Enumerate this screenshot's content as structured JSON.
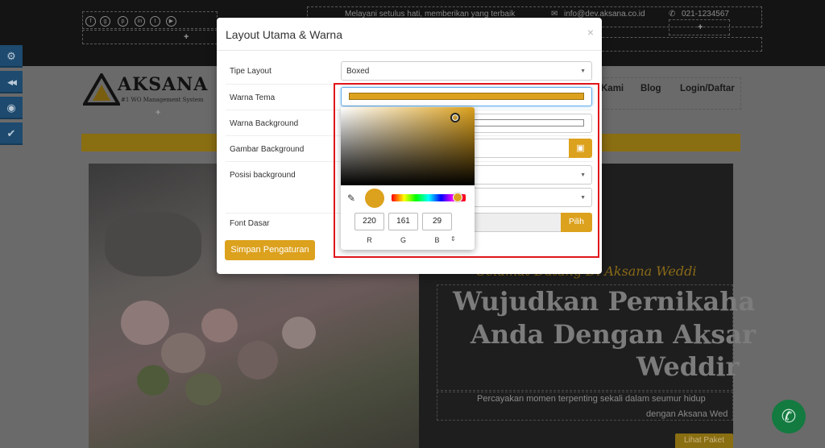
{
  "background_page": {
    "top_bar": {
      "tagline": "Melayani setulus hati, memberikan yang terbaik",
      "email": "info@dev.aksana.co.id",
      "phone": "021-1234567",
      "add_symbol": "+"
    },
    "logo": {
      "name": "AKSANA",
      "tagline": "#1 WO Management System"
    },
    "nav": [
      {
        "label": "Kami"
      },
      {
        "label": "Blog"
      },
      {
        "label": "Login/Daftar"
      }
    ],
    "hero": {
      "script_line": "Selamat Datang Di Aksana Weddi",
      "title_lines": [
        "Wujudkan Pernikaha",
        "Anda Dengan Aksar",
        "Weddir"
      ],
      "subtitle_lines": [
        "Percayakan momen terpenting sekali dalam seumur hidup",
        "dengan Aksana Wed"
      ],
      "button_peek": "Lihat Paket"
    }
  },
  "sidebar_tools": [
    {
      "icon": "gears-icon",
      "glyph": "⚙"
    },
    {
      "icon": "rewind-icon",
      "glyph": "◀◀"
    },
    {
      "icon": "eye-icon",
      "glyph": "◉"
    },
    {
      "icon": "check-icon",
      "glyph": "✔"
    }
  ],
  "modal": {
    "title": "Layout Utama & Warna",
    "close": "×",
    "fields": {
      "tipe_layout": {
        "label": "Tipe Layout",
        "value": "Boxed"
      },
      "warna_tema": {
        "label": "Warna Tema"
      },
      "warna_background": {
        "label": "Warna Background"
      },
      "gambar_background": {
        "label": "Gambar Background"
      },
      "posisi_background": {
        "label": "Posisi background"
      },
      "font_dasar": {
        "label": "Font Dasar",
        "button": "Pilih"
      }
    },
    "save_label": "Simpan Pengaturan"
  },
  "color_picker": {
    "r": "220",
    "g": "161",
    "b": "29",
    "labels": {
      "r": "R",
      "g": "G",
      "b": "B"
    },
    "format_toggle": "⇕"
  },
  "colors": {
    "theme_gold": "#dca11d",
    "highlight_red": "#e0161b",
    "dark_topbar": "#141414"
  }
}
